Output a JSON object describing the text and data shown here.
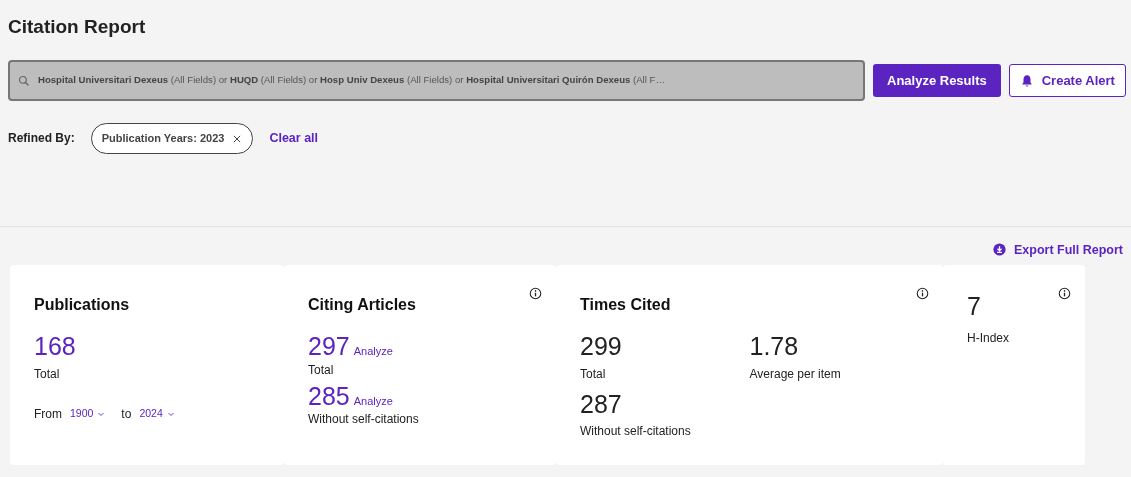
{
  "title": "Citation Report",
  "search": {
    "query": "**Hospital Universitari Dexeus** (All Fields) or **HUQD** (All Fields) or **Hosp Univ Dexeus** (All Fields) or **Hospital Universitari Quirón Dexeus** (All F…"
  },
  "buttons": [
    {
      "label": "Analyze Results",
      "kind": "primary"
    },
    {
      "label": "Create Alert",
      "kind": "alert"
    }
  ],
  "refined": {
    "label": "Refined By:",
    "chips": [
      "Publication Years: 2023"
    ],
    "clear": "Clear all"
  },
  "export": "Export Full Report",
  "cards": [
    {
      "kind": "publications",
      "title": "Publications",
      "info": false,
      "value": "168",
      "label": "Total",
      "from_label": "From",
      "from_year": "1900",
      "to_label": "to",
      "to_year": "2024"
    },
    {
      "kind": "citing",
      "title": "Citing Articles",
      "info": true,
      "metrics": [
        {
          "value": "297",
          "link": "Analyze",
          "label": "Total"
        },
        {
          "value": "285",
          "link": "Analyze",
          "label": "Without self-citations"
        }
      ]
    },
    {
      "kind": "times",
      "title": "Times Cited",
      "info": true,
      "metrics": [
        {
          "value": "299",
          "label": "Total"
        },
        {
          "value": "1.78",
          "label": "Average per item"
        },
        {
          "value": "287",
          "label": "Without self-citations"
        }
      ]
    },
    {
      "kind": "hindex",
      "info": true,
      "value": "7",
      "label": "H-Index"
    }
  ]
}
